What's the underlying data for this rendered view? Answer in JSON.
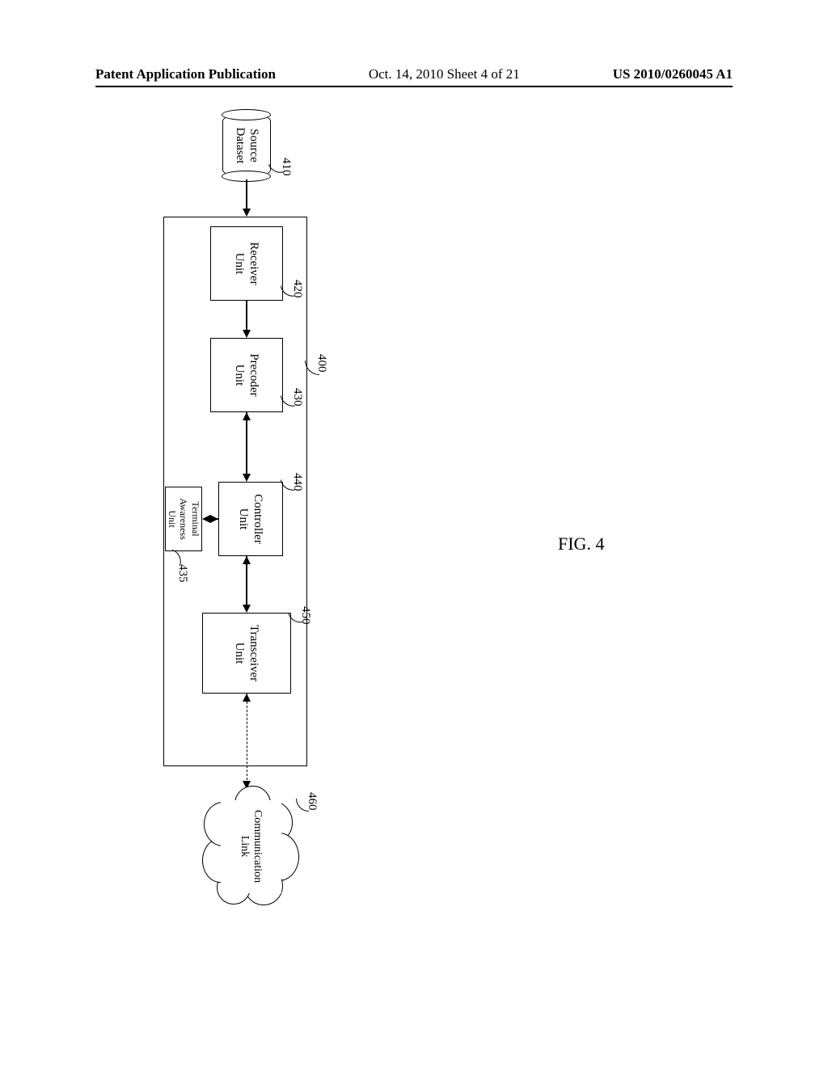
{
  "header": {
    "left": "Patent Application Publication",
    "mid": "Oct. 14, 2010  Sheet 4 of 21",
    "right": "US 2010/0260045 A1"
  },
  "figure_label": "FIG. 4",
  "refs": {
    "r400": "400",
    "r410": "410",
    "r420": "420",
    "r430": "430",
    "r435": "435",
    "r440": "440",
    "r450": "450",
    "r460": "460"
  },
  "blocks": {
    "source": "Source\nDataset",
    "receiver": "Receiver\nUnit",
    "precoder": "Precoder\nUnit",
    "controller": "Controller\nUnit",
    "terminal": "Terminal\nAwareness\nUnit",
    "transceiver": "Transceiver\nUnit",
    "cloud": "Communication\nLink"
  }
}
